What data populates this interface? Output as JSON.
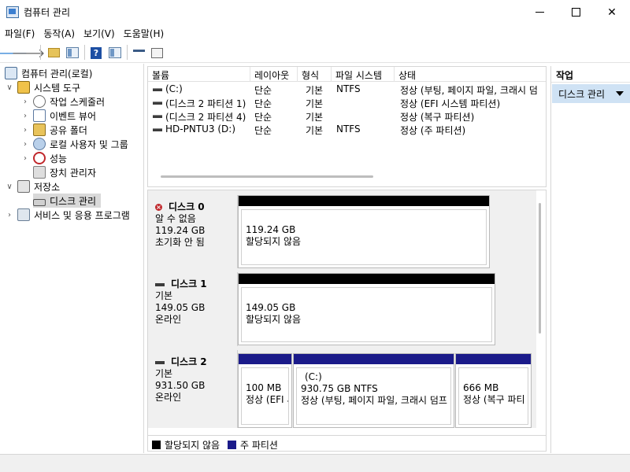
{
  "window": {
    "title": "컴퓨터 관리"
  },
  "menu": [
    "파일(F)",
    "동작(A)",
    "보기(V)",
    "도움말(H)"
  ],
  "toolbar": {
    "icons": [
      "back-arrow-icon",
      "forward-arrow-icon",
      "up-folder-icon",
      "console-tree-icon",
      "help-icon",
      "action-pane-icon",
      "connect-icon",
      "properties-icon"
    ]
  },
  "tree": {
    "root": "컴퓨터 관리(로컬)",
    "system_tools": "시스템 도구",
    "task_scheduler": "작업 스케줄러",
    "event_viewer": "이벤트 뷰어",
    "shared_folders": "공유 폴더",
    "local_users": "로컬 사용자 및 그룹",
    "performance": "성능",
    "device_manager": "장치 관리자",
    "storage": "저장소",
    "disk_management": "디스크 관리",
    "services": "서비스 및 응용 프로그램"
  },
  "volume_list": {
    "columns": [
      "볼륨",
      "레이아웃",
      "형식",
      "파일 시스템",
      "상태"
    ],
    "rows": [
      {
        "volume": "(C:)",
        "layout": "단순",
        "type": "기본",
        "fs": "NTFS",
        "status": "정상 (부팅, 페이지 파일, 크래시 덤"
      },
      {
        "volume": "(디스크 2 파티션 1)",
        "layout": "단순",
        "type": "기본",
        "fs": "",
        "status": "정상 (EFI 시스템 파티션)"
      },
      {
        "volume": "(디스크 2 파티션 4)",
        "layout": "단순",
        "type": "기본",
        "fs": "",
        "status": "정상 (복구 파티션)"
      },
      {
        "volume": "HD-PNTU3 (D:)",
        "layout": "단순",
        "type": "기본",
        "fs": "NTFS",
        "status": "정상 (주 파티션)"
      }
    ]
  },
  "disks": [
    {
      "name": "디스크 0",
      "line1": "알 수 없음",
      "line2": "119.24 GB",
      "line3": "초기화 안 됨",
      "partitions": [
        {
          "size": "119.24 GB",
          "status": "할당되지 않음"
        }
      ]
    },
    {
      "name": "디스크 1",
      "line1": "기본",
      "line2": "149.05 GB",
      "line3": "온라인",
      "partitions": [
        {
          "size": "149.05 GB",
          "status": "할당되지 않음"
        }
      ]
    },
    {
      "name": "디스크 2",
      "line1": "기본",
      "line2": "931.50 GB",
      "line3": "온라인",
      "partitions": [
        {
          "label": "",
          "size": "100 MB",
          "status": "정상 (EFI 시"
        },
        {
          "label": "(C:)",
          "size": "930.75 GB NTFS",
          "status": "정상 (부팅, 페이지 파일, 크래시 덤프"
        },
        {
          "label": "",
          "size": "666 MB",
          "status": "정상 (복구 파티"
        }
      ]
    }
  ],
  "legend": {
    "unallocated": "할당되지 않음",
    "primary": "주 파티션"
  },
  "actions": {
    "header": "작업",
    "item": "디스크 관리"
  },
  "colors": {
    "primary_partition": "#1b1b8a",
    "unallocated": "#000000",
    "selection": "#cfe2f4"
  }
}
